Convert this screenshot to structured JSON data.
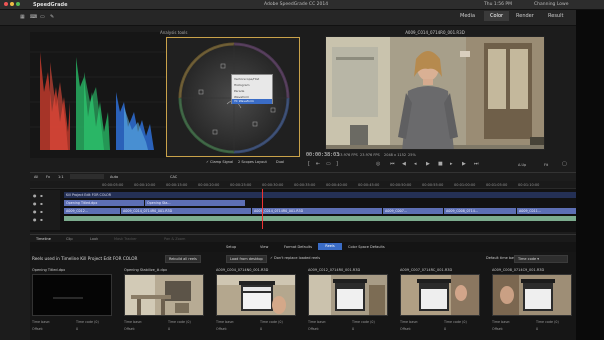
{
  "window": {
    "app_menu": "SpeedGrade",
    "title": "Adobe SpeedGrade CC 2014",
    "clock": "Thu 1:56 PM",
    "user": "Channing Lowe"
  },
  "top_tabs": [
    {
      "label": "Media",
      "active": false
    },
    {
      "label": "Color",
      "active": true
    },
    {
      "label": "Render",
      "active": false
    },
    {
      "label": "Result",
      "active": false
    }
  ],
  "scopes": {
    "title": "Analysis tools",
    "controls": {
      "clamp_signal": "Clamp Signal",
      "layout": "2 Scopes Layout",
      "mode": "Dual"
    },
    "context_menu": [
      "Vectorscope/Hist",
      "Histogram",
      "Parade",
      "Waveform",
      "YC Waveform"
    ],
    "menu_selected_index": 4
  },
  "viewer": {
    "clip_name": "A009_C014_0714R0_001.R3D",
    "timecode": "00:00:38:03",
    "fps": "23.976 FPS",
    "fps2": "23.976 FPS",
    "resolution": "2048 x 1152",
    "zoom": "25%",
    "fit": "Fit",
    "mode": "A.Up"
  },
  "timeline": {
    "controls": [
      "All",
      "Fx",
      "1:1",
      "Auto",
      "CAC"
    ],
    "ruler": [
      "00:00:05:00",
      "00:00:10:00",
      "00:00:15:00",
      "00:00:20:00",
      "00:00:25:00",
      "00:00:30:00",
      "00:00:35:00",
      "00:00:40:00",
      "00:00:45:00",
      "00:00:50:00",
      "00:00:55:00",
      "00:01:00:00",
      "00:01:05:00",
      "00:01:10:00"
    ],
    "sequence_label": "Kill Project Edit FOR COLOR",
    "clips_row1": [
      "Opening Titled.dpx",
      "Opening Sta..."
    ],
    "clips_row2": [
      "A009_C012...",
      "A009_C014_0714R0_001.R3D",
      "A009_C014_0714R0_001.R3D",
      "A009_C007...",
      "A009_C008_0714...",
      "A009_C011..."
    ]
  },
  "bottom_tabs": [
    "Timeline",
    "Clip",
    "Look",
    "Mask Tracker",
    "Pan & Zoom"
  ],
  "subtabs": [
    {
      "label": "Setup",
      "active": false
    },
    {
      "label": "View",
      "active": false
    },
    {
      "label": "Format Defaults",
      "active": false
    },
    {
      "label": "Reels",
      "active": true
    },
    {
      "label": "Color Space Defaults",
      "active": false
    }
  ],
  "reels": {
    "heading": "Reels used in Timeline Kill Project Edit FOR COLOR",
    "rebuild_label": "Rebuild all reels",
    "load_label": "Load from desktop",
    "replace_label": "Don't replace loaded reels",
    "default_timebase_label": "Default time base",
    "default_timebase_value": "Time code",
    "items": [
      {
        "name": "Opening Titled.dpx",
        "time_base": "Time base:",
        "time_base_value": "Time code (0)",
        "offset": "Offset:",
        "offset_value": "0"
      },
      {
        "name": "Opening Stabilize_#.dpx",
        "time_base": "Time base:",
        "time_base_value": "Time code (0)",
        "offset": "Offset:",
        "offset_value": "0"
      },
      {
        "name": "A009_C004_0714N0_001.R3D",
        "time_base": "Time base:",
        "time_base_value": "Time code (0)",
        "offset": "Offset:",
        "offset_value": "0"
      },
      {
        "name": "A009_C012_0714R0_001.R3D",
        "time_base": "Time base:",
        "time_base_value": "Time code (0)",
        "offset": "Offset:",
        "offset_value": "0"
      },
      {
        "name": "A009_C007_0714RC_001.R3D",
        "time_base": "Time base:",
        "time_base_value": "Time code (0)",
        "offset": "Offset:",
        "offset_value": "0"
      },
      {
        "name": "A009_C008_0714C9_001.R3D",
        "time_base": "Time base:",
        "time_base_value": "Time code (0)",
        "offset": "Offset:",
        "offset_value": "0"
      }
    ]
  },
  "colors": {
    "accent": "#3a6cc6",
    "panel": "#161616",
    "clip_blue": "#5d6fb4",
    "clip_green": "#8fc8a4"
  }
}
